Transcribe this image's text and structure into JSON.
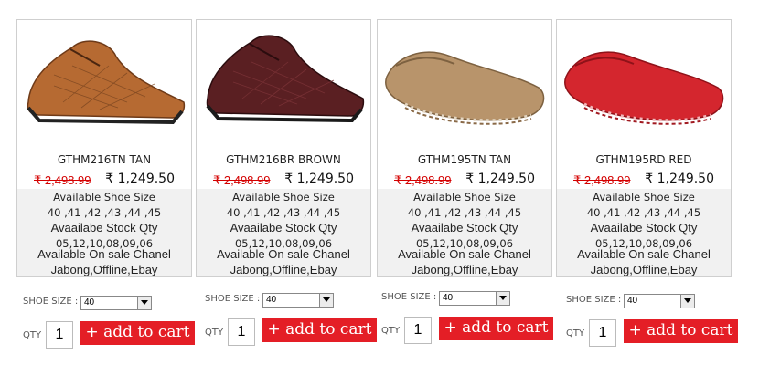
{
  "products": [
    {
      "name": "GTHM216TN TAN",
      "old_price": "₹ 2,498.99",
      "new_price": "₹ 1,249.50",
      "size_heading": "Available Shoe Size",
      "sizes": "40 ,41 ,42 ,43 ,44 ,45",
      "stock_heading": "Avaailabe Stock Qty",
      "stock": "05,12,10,08,09,06",
      "channel_heading": "Available On sale Chanel",
      "channels": "Jabong,Offline,Ebay",
      "shoe_size_label": "SHOE SIZE :",
      "shoe_size_value": "40",
      "qty_label": "QTY",
      "qty_value": "1",
      "add_label": "+ add to cart",
      "color": "#b66a32"
    },
    {
      "name": "GTHM216BR BROWN",
      "old_price": "₹ 2,498.99",
      "new_price": "₹ 1,249.50",
      "size_heading": "Available Shoe Size",
      "sizes": "40 ,41 ,42 ,43 ,44 ,45",
      "stock_heading": "Avaailabe Stock Qty",
      "stock": "05,12,10,08,09,06",
      "channel_heading": "Available On sale Chanel",
      "channels": "Jabong,Offline,Ebay",
      "shoe_size_label": "SHOE SIZE :",
      "shoe_size_value": "40",
      "qty_label": "QTY",
      "qty_value": "1",
      "add_label": "+ add to cart",
      "color": "#5a1f22"
    },
    {
      "name": "GTHM195TN TAN",
      "old_price": "₹ 2,498.99",
      "new_price": "₹ 1,249.50",
      "size_heading": "Available Shoe Size",
      "sizes": "40 ,41 ,42 ,43 ,44 ,45",
      "stock_heading": "Avaailabe Stock Qty",
      "stock": "05,12,10,08,09,06",
      "channel_heading": "Available On sale Chanel",
      "channels": "Jabong,Offline,Ebay",
      "shoe_size_label": "SHOE SIZE :",
      "shoe_size_value": "40",
      "qty_label": "QTY",
      "qty_value": "1",
      "add_label": "+ add to cart",
      "color": "#b8946b"
    },
    {
      "name": "GTHM195RD RED",
      "old_price": "₹ 2,498.99",
      "new_price": "₹ 1,249.50",
      "size_heading": "Available Shoe Size",
      "sizes": "40 ,41 ,42 ,43 ,44 ,45",
      "stock_heading": "Avaailabe Stock Qty",
      "stock": "05,12,10,08,09,06",
      "channel_heading": "Available On sale Chanel",
      "channels": "Jabong,Offline,Ebay",
      "shoe_size_label": "SHOE SIZE :",
      "shoe_size_value": "40",
      "qty_label": "QTY",
      "qty_value": "1",
      "add_label": "+ add to cart",
      "color": "#d4262e"
    }
  ]
}
